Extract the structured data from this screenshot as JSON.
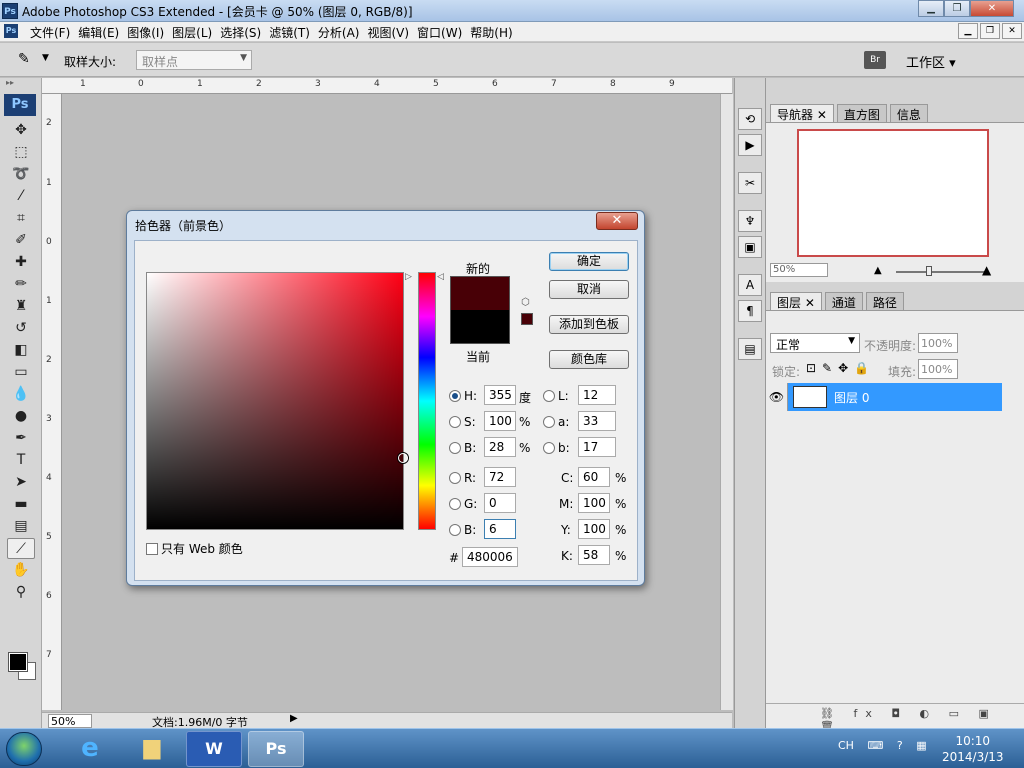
{
  "app": {
    "title": "Adobe Photoshop CS3 Extended - [会员卡 @ 50% (图层 0, RGB/8)]",
    "logo": "Ps"
  },
  "menu": [
    "文件(F)",
    "编辑(E)",
    "图像(I)",
    "图层(L)",
    "选择(S)",
    "滤镜(T)",
    "分析(A)",
    "视图(V)",
    "窗口(W)",
    "帮助(H)"
  ],
  "options": {
    "sample_label": "取样大小:",
    "sample_value": "取样点",
    "workspace": "工作区 ▾"
  },
  "toolbox": {
    "logo": "Ps"
  },
  "rulers": {
    "h": [
      "1",
      "0",
      "1",
      "2",
      "3",
      "4",
      "5",
      "6",
      "7",
      "8",
      "9"
    ],
    "v": [
      "2",
      "1",
      "0",
      "1",
      "2",
      "3",
      "4",
      "5",
      "6",
      "7"
    ]
  },
  "status": {
    "zoom": "50%",
    "doc": "文档:1.96M/0 字节"
  },
  "navigator": {
    "tabs": [
      "导航器",
      "直方图",
      "信息"
    ],
    "zoom": "50%"
  },
  "layers": {
    "tabs": [
      "图层",
      "通道",
      "路径"
    ],
    "blend_mode": "正常",
    "opacity_label": "不透明度:",
    "opacity_value": "100%",
    "lock_label": "锁定:",
    "fill_label": "填充:",
    "fill_value": "100%",
    "layer_name": "图层 0"
  },
  "dialog": {
    "title": "拾色器（前景色）",
    "new_label": "新的",
    "current_label": "当前",
    "buttons": {
      "ok": "确定",
      "cancel": "取消",
      "add_swatch": "添加到色板",
      "libraries": "颜色库"
    },
    "web_only": "只有 Web 颜色",
    "fields": {
      "H": "355",
      "S": "100",
      "B": "28",
      "R": "72",
      "G": "0",
      "Bb": "6",
      "L": "12",
      "a": "33",
      "b": "17",
      "C": "60",
      "M": "100",
      "Y": "100",
      "K": "58",
      "hex": "480006"
    },
    "units": {
      "deg": "度",
      "pct": "%"
    },
    "labels": {
      "H": "H:",
      "S": "S:",
      "B": "B:",
      "R": "R:",
      "G": "G:",
      "Bb": "B:",
      "L": "L:",
      "a": "a:",
      "b": "b:",
      "C": "C:",
      "M": "M:",
      "Y": "Y:",
      "K": "K:",
      "hash": "#"
    },
    "colors": {
      "new": "#480006",
      "current": "#000000"
    }
  },
  "taskbar": {
    "tray_lang": "CH",
    "time": "10:10",
    "date": "2014/3/13",
    "apps": [
      "ie-icon",
      "explorer-icon",
      "word-icon",
      "photoshop-icon"
    ],
    "ps_label": "Ps",
    "word_label": "W"
  }
}
